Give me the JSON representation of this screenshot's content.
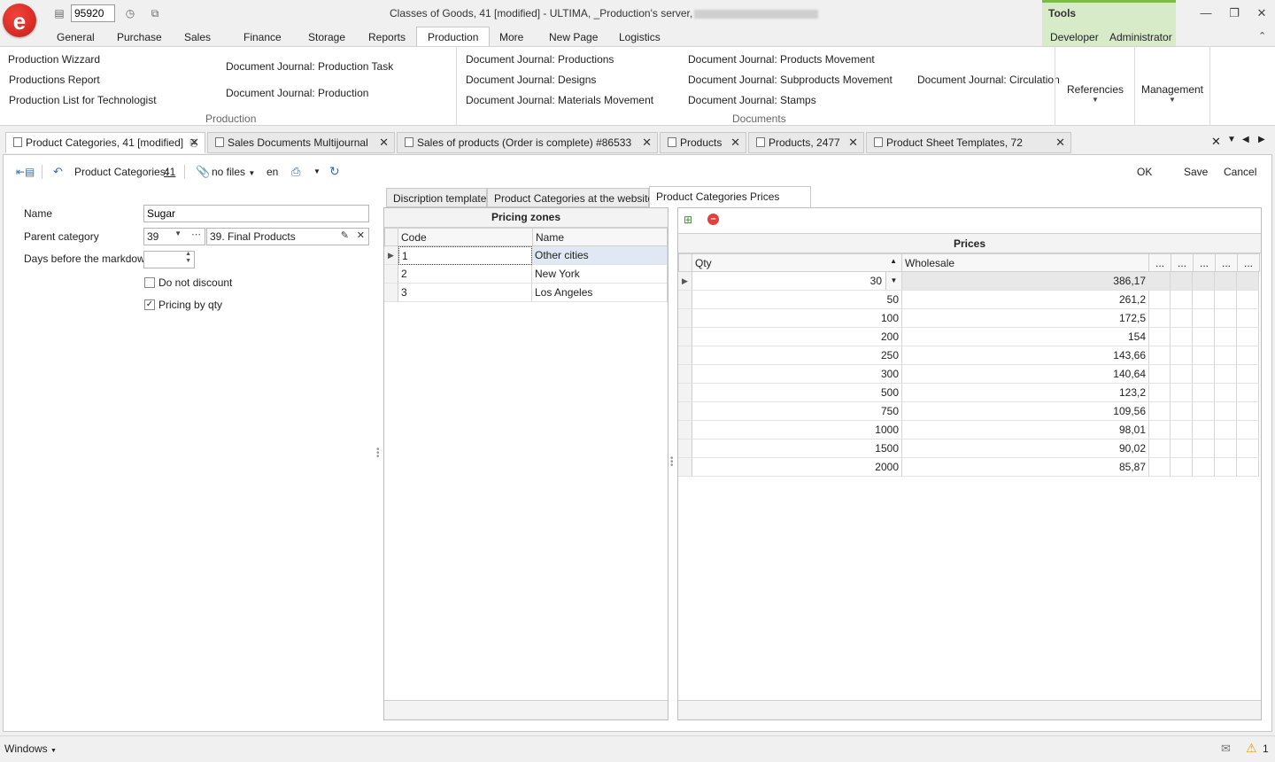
{
  "app": {
    "logo_letter": "e",
    "doc_number": "95920",
    "window_title": "Classes of Goods, 41 [modified] - ULTIMA, _Production's server,",
    "tools_label": "Tools",
    "colors": {
      "accent": "#7bbb4b",
      "logo": "#e0302a"
    }
  },
  "menu": {
    "tabs": [
      "General",
      "Purchase",
      "Sales",
      "Finance",
      "Storage",
      "Reports",
      "Production",
      "More",
      "New Page",
      "Logistics"
    ],
    "active": "Production",
    "tools_tabs": [
      "Developer",
      "Administrator"
    ]
  },
  "ribbon": {
    "production_group": {
      "label": "Production",
      "items": [
        "Production Wizzard",
        "Productions Report",
        "Production List for Technologist",
        "Document Journal: Production Task",
        "Document Journal: Production"
      ]
    },
    "documents_group": {
      "label": "Documents",
      "items": [
        "Document Journal: Productions",
        "Document Journal: Designs",
        "Document Journal: Materials Movement",
        "Document Journal: Products Movement",
        "Document Journal: Subproducts Movement",
        "Document Journal: Stamps",
        "Document Journal: Circulation"
      ]
    },
    "references_label": "Referencies",
    "management_label": "Management"
  },
  "doc_tabs": [
    "Product Categories, 41 [modified]",
    "Sales Documents Multijournal",
    "Sales of products (Order is complete) #86533",
    "Products",
    "Products, 2477",
    "Product Sheet Templates, 72"
  ],
  "toolbar": {
    "record_label": "Product Categories:",
    "record_id": "41",
    "files_label": "no files",
    "lang": "en",
    "ok_label": "OK",
    "save_label": "Save",
    "cancel_label": "Cancel"
  },
  "form": {
    "name_label": "Name",
    "name_value": "Sugar",
    "parent_label": "Parent category",
    "parent_code": "39",
    "parent_name": "39. Final Products",
    "days_label": "Days before the markdown",
    "days_value": "",
    "no_discount_label": "Do not discount",
    "no_discount_checked": false,
    "pricing_qty_label": "Pricing by qty",
    "pricing_qty_checked": true
  },
  "sub_tabs": [
    "Discription template",
    "Product Categories at the website",
    "Product Categories Prices"
  ],
  "pricing_zones": {
    "title": "Pricing zones",
    "columns": [
      "Code",
      "Name"
    ],
    "rows": [
      {
        "code": "1",
        "name": "Other cities"
      },
      {
        "code": "2",
        "name": "New York"
      },
      {
        "code": "3",
        "name": "Los Angeles"
      }
    ]
  },
  "prices": {
    "title": "Prices",
    "columns": [
      "Qty",
      "Wholesale"
    ],
    "extra_col_label": "...",
    "rows": [
      {
        "qty": "30",
        "wholesale": "386,17"
      },
      {
        "qty": "50",
        "wholesale": "261,2"
      },
      {
        "qty": "100",
        "wholesale": "172,5"
      },
      {
        "qty": "200",
        "wholesale": "154"
      },
      {
        "qty": "250",
        "wholesale": "143,66"
      },
      {
        "qty": "300",
        "wholesale": "140,64"
      },
      {
        "qty": "500",
        "wholesale": "123,2"
      },
      {
        "qty": "750",
        "wholesale": "109,56"
      },
      {
        "qty": "1000",
        "wholesale": "98,01"
      },
      {
        "qty": "1500",
        "wholesale": "90,02"
      },
      {
        "qty": "2000",
        "wholesale": "85,87"
      }
    ]
  },
  "statusbar": {
    "windows_label": "Windows",
    "warning_count": "1"
  }
}
